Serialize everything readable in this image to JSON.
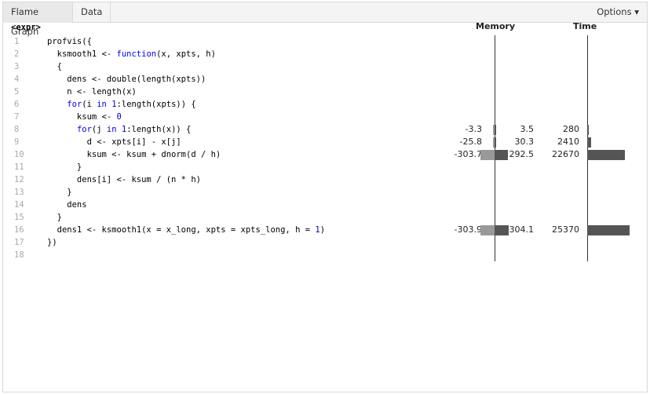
{
  "tabs": [
    {
      "label": "Flame Graph",
      "active": true
    },
    {
      "label": "Data",
      "active": false
    }
  ],
  "options_label": "Options ▾",
  "expr_label": "<expr>",
  "columns": {
    "memory": "Memory",
    "time": "Time"
  },
  "lines": [
    {
      "n": "1",
      "code": "profvis({"
    },
    {
      "n": "2",
      "code": "  ksmooth1 <- function(x, xpts, h)"
    },
    {
      "n": "3",
      "code": "  {"
    },
    {
      "n": "4",
      "code": "    dens <- double(length(xpts))"
    },
    {
      "n": "5",
      "code": "    n <- length(x)"
    },
    {
      "n": "6",
      "code": "    for(i in 1:length(xpts)) {"
    },
    {
      "n": "7",
      "code": "      ksum <- 0"
    },
    {
      "n": "8",
      "code": "      for(j in 1:length(x)) {",
      "mem_neg": "-3.3",
      "mem_pos": "3.5",
      "time": "280",
      "mem_neg_v": -3.3,
      "mem_pos_v": 3.5,
      "time_v": 280
    },
    {
      "n": "9",
      "code": "        d <- xpts[i] - x[j]",
      "mem_neg": "-25.8",
      "mem_pos": "30.3",
      "time": "2410",
      "mem_neg_v": -25.8,
      "mem_pos_v": 30.3,
      "time_v": 2410
    },
    {
      "n": "10",
      "code": "        ksum <- ksum + dnorm(d / h)",
      "mem_neg": "-303.7",
      "mem_pos": "292.5",
      "time": "22670",
      "mem_neg_v": -303.7,
      "mem_pos_v": 292.5,
      "time_v": 22670
    },
    {
      "n": "11",
      "code": "      }"
    },
    {
      "n": "12",
      "code": "      dens[i] <- ksum / (n * h)"
    },
    {
      "n": "13",
      "code": "    }"
    },
    {
      "n": "14",
      "code": "    dens"
    },
    {
      "n": "15",
      "code": "  }"
    },
    {
      "n": "16",
      "code": "  dens1 <- ksmooth1(x = x_long, xpts = xpts_long, h = 1)",
      "mem_neg": "-303.9",
      "mem_pos": "304.1",
      "time": "25370",
      "mem_neg_v": -303.9,
      "mem_pos_v": 304.1,
      "time_v": 25370
    },
    {
      "n": "17",
      "code": "})"
    },
    {
      "n": "18",
      "code": ""
    }
  ]
}
